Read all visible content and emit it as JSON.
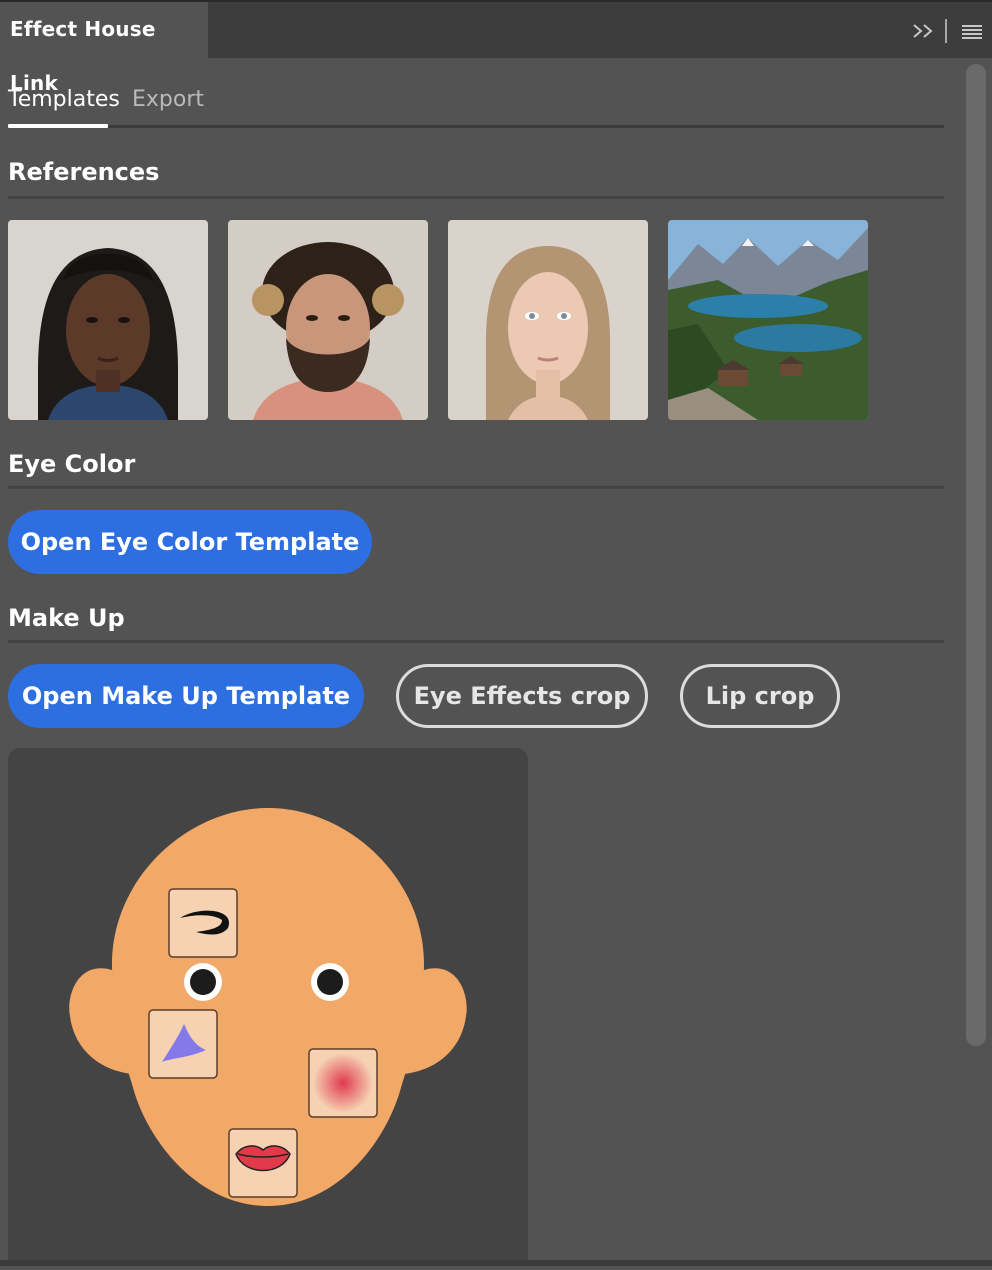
{
  "panel": {
    "title": "Effect House Link",
    "expand_icon": "double-chevron-right-icon",
    "menu_icon": "hamburger-menu-icon"
  },
  "tabs": [
    {
      "label": "Templates",
      "active": true
    },
    {
      "label": "Export",
      "active": false
    }
  ],
  "sections": {
    "references": {
      "title": "References",
      "thumbnails": [
        {
          "name": "reference-portrait-woman-braids"
        },
        {
          "name": "reference-portrait-man-curly"
        },
        {
          "name": "reference-portrait-woman-blonde"
        },
        {
          "name": "reference-landscape-mountain-lake"
        }
      ]
    },
    "eye_color": {
      "title": "Eye Color",
      "button_label": "Open Eye Color Template"
    },
    "make_up": {
      "title": "Make Up",
      "open_button_label": "Open Make Up Template",
      "eye_effects_button_label": "Eye Effects crop",
      "lip_button_label": "Lip crop"
    }
  },
  "colors": {
    "panel_bg": "#535353",
    "header_bg": "#3d3d3d",
    "accent_blue": "#2d6fe0",
    "face_skin": "#f2a866",
    "tile_bg": "#f6d2b3"
  }
}
